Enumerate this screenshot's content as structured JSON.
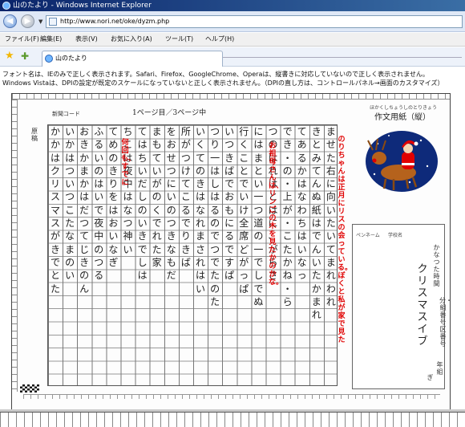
{
  "window": {
    "title": "山のたより - Windows Internet Explorer"
  },
  "nav": {
    "back_glyph": "◀",
    "forward_glyph": "▶",
    "dropdown_glyph": "▼",
    "url": "http://www.nori.net/oke/dyzm.php"
  },
  "menu": {
    "items": [
      "ファイル(F)",
      "編集(E)",
      "表示(V)",
      "お気に入り(A)",
      "ツール(T)",
      "ヘルプ(H)"
    ]
  },
  "favorites": {
    "star_glyph": "★",
    "add_glyph": "✚"
  },
  "tab": {
    "label": "山のたより"
  },
  "notice": {
    "line1": "フォント名は、IEのみで正しく表示されます。Safari、Firefox、GoogleChrome、Operaは、縦書きに対応していないので正しく表示されません。",
    "line2": "Windows Vistaは、DPIの設定が既定のスケールになっていないと正しく表示されません。（DPIの直し方は、コントロールパネル→画面のカスタマイズ）"
  },
  "sheet": {
    "header_left": "新聞コード",
    "page_marker": "1ページ目／3ページ中",
    "side_label": "原稿",
    "title_small": "ほかくしちょうしのとりきょう",
    "title": "作文用紙（縦）",
    "columns": [
      "ませた右に向いたいてまれわれ",
      "きとみてんぬ紙はでんいたかまれ",
      "てあるかはなわちはいなっ",
      "でき・の・上が・こたかね・ら",
      "つのはれはとはに、がらさ",
      "にはまとい一つ道の一でしでぬ",
      "行くことでいけ全席どがっぱ",
      "いつきばでおもにるですぱ",
      "つり一はしはるのでつでたのた",
      "いくてのきはなれまされはい",
      "所がつけてこるでりきば",
      "をおせつにいのつきなもだ",
      "まもていがのくでれた家",
      "てはちいだしのいきでしは",
      "ちこは夜中はなつ神い",
      "てめのきりをはおいなぎ",
      "ふるいのはいで夜中のつる",
      "おきかまかはだつてじきのん",
      "いかはついつこたなまのい",
      "かかはクリスマスがきでとた"
    ],
    "red_notes": [
      "何回も、すでに",
      "お祖母さんは、リンごの木を見たかのかな。",
      "のりちゃんは正月にリスの会っている。ぼくと私が家で見た"
    ],
    "info": {
      "label_name": "ペンネーム",
      "label_school": "学校名",
      "vertical_title": "クリスマスイブ",
      "right_col1": "かなつた時間",
      "right_col2": "分・組番号　区番号",
      "right_col3": "年組",
      "right_col4": "ぎ"
    }
  }
}
